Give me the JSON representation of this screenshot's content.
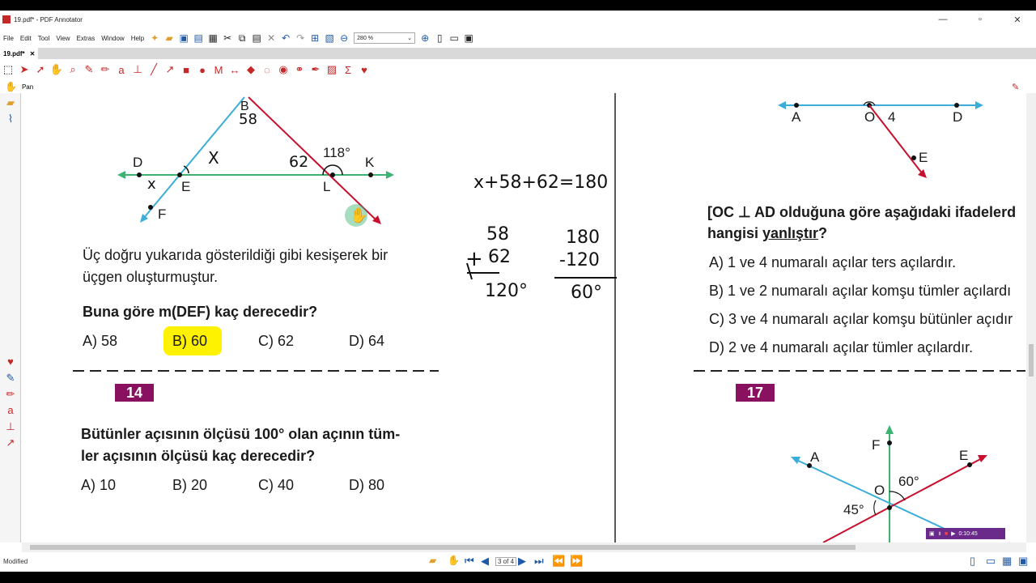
{
  "window": {
    "title": "19.pdf* - PDF Annotator"
  },
  "menu": {
    "items": [
      "File",
      "Edit",
      "Tool",
      "View",
      "Extras",
      "Window",
      "Help"
    ]
  },
  "toolbar": {
    "zoom": "280 %"
  },
  "tabs": [
    {
      "label": "19.pdf*"
    }
  ],
  "tool": {
    "active_label": "Pan"
  },
  "page": {
    "left": {
      "fig_labels": {
        "B": "B",
        "D": "D",
        "E": "E",
        "F": "F",
        "L": "L",
        "K": "K",
        "angle118": "118°",
        "x": "x"
      },
      "handwritten": {
        "b58": "58",
        "a62": "62",
        "x1": "X",
        "x2": "x"
      },
      "text1": "Üç doğru yukarıda gösterildiği gibi kesişerek bir",
      "text2": "üçgen oluşturmuştur.",
      "question": "Buna göre m(DEF) kaç derecedir?",
      "options": [
        "A) 58",
        "B) 60",
        "C) 62",
        "D) 64"
      ],
      "q14_number": "14",
      "q14_line1": "Bütünler açısının ölçüsü 100° olan açının tüm-",
      "q14_line2": "ler açısının ölçüsü kaç derecedir?",
      "q14_options": [
        "A) 10",
        "B) 20",
        "C) 40",
        "D) 80"
      ]
    },
    "middle": {
      "equation": "x+58+62=180",
      "add_top": "58",
      "add_bottom": "62",
      "add_result": "120°",
      "sub_top": "180",
      "sub_bottom": "-120",
      "sub_result": "60°"
    },
    "right": {
      "fig_top_labels": {
        "A": "A",
        "O": "O",
        "n4": "4",
        "D": "D",
        "E": "E"
      },
      "q_line1": "[OC ⊥ AD olduğuna göre aşağıdaki ifadelerd",
      "q_line2_a": "hangisi ",
      "q_line2_b": "yanlıştır",
      "q_line2_c": "?",
      "options": [
        "A)  1 ve 4 numaralı açılar ters açılardır.",
        "B)  1 ve 2 numaralı açılar komşu tümler açılardı",
        "C)  3 ve 4 numaralı açılar komşu bütünler açıdır",
        "D)  2 ve 4 numaralı açılar tümler açılardır."
      ],
      "q17_number": "17",
      "fig2_labels": {
        "F": "F",
        "A": "A",
        "E": "E",
        "O": "O",
        "a60": "60°",
        "a45": "45°"
      }
    }
  },
  "status": {
    "text": "Modified",
    "page_indicator": "3 of 4"
  },
  "recorder": {
    "time": "0:10:45"
  },
  "colors": {
    "accent_red": "#c62828",
    "line_blue": "#3aaed8",
    "line_green": "#3cb371",
    "line_red": "#c8102e",
    "badge": "#8a1060",
    "highlight": "#fff200"
  }
}
